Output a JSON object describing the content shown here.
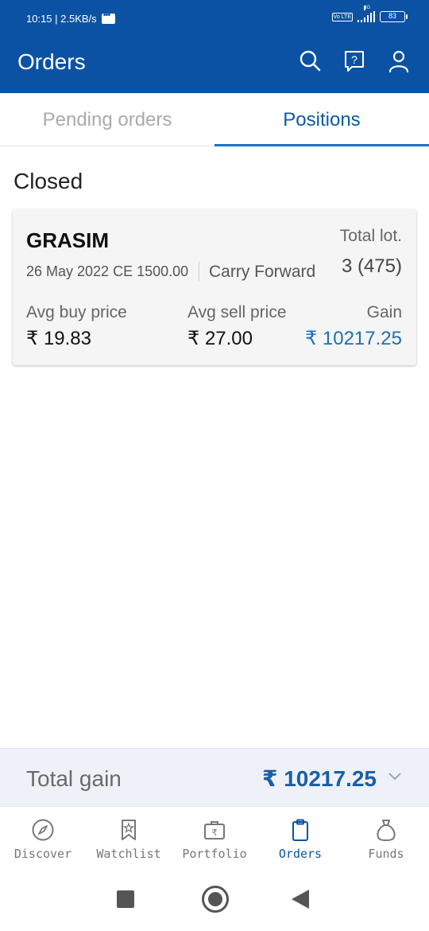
{
  "status_bar": {
    "time_speed": "10:15 | 2.5KB/s",
    "volte": "Vo LTE",
    "network": "4G",
    "battery": "83"
  },
  "app_bar": {
    "title": "Orders"
  },
  "tabs": [
    {
      "label": "Pending orders",
      "active": false
    },
    {
      "label": "Positions",
      "active": true
    }
  ],
  "section": {
    "title": "Closed"
  },
  "position_card": {
    "symbol": "GRASIM",
    "contract": "26 May 2022 CE 1500.00",
    "product": "Carry Forward",
    "total_lot_label": "Total lot.",
    "total_lot_value": "3 (475)",
    "avg_buy_label": "Avg buy price",
    "avg_buy_value": "₹ 19.83",
    "avg_sell_label": "Avg sell price",
    "avg_sell_value": "₹ 27.00",
    "gain_label": "Gain",
    "gain_value": "₹ 10217.25"
  },
  "total": {
    "label": "Total gain",
    "value": "₹ 10217.25"
  },
  "bottom_nav": [
    {
      "label": "Discover",
      "icon": "compass-icon",
      "active": false
    },
    {
      "label": "Watchlist",
      "icon": "bookmark-icon",
      "active": false
    },
    {
      "label": "Portfolio",
      "icon": "briefcase-icon",
      "active": false
    },
    {
      "label": "Orders",
      "icon": "clipboard-icon",
      "active": true
    },
    {
      "label": "Funds",
      "icon": "money-bag-icon",
      "active": false
    }
  ],
  "colors": {
    "brand": "#0b52a4",
    "gain": "#1d6fb8"
  }
}
